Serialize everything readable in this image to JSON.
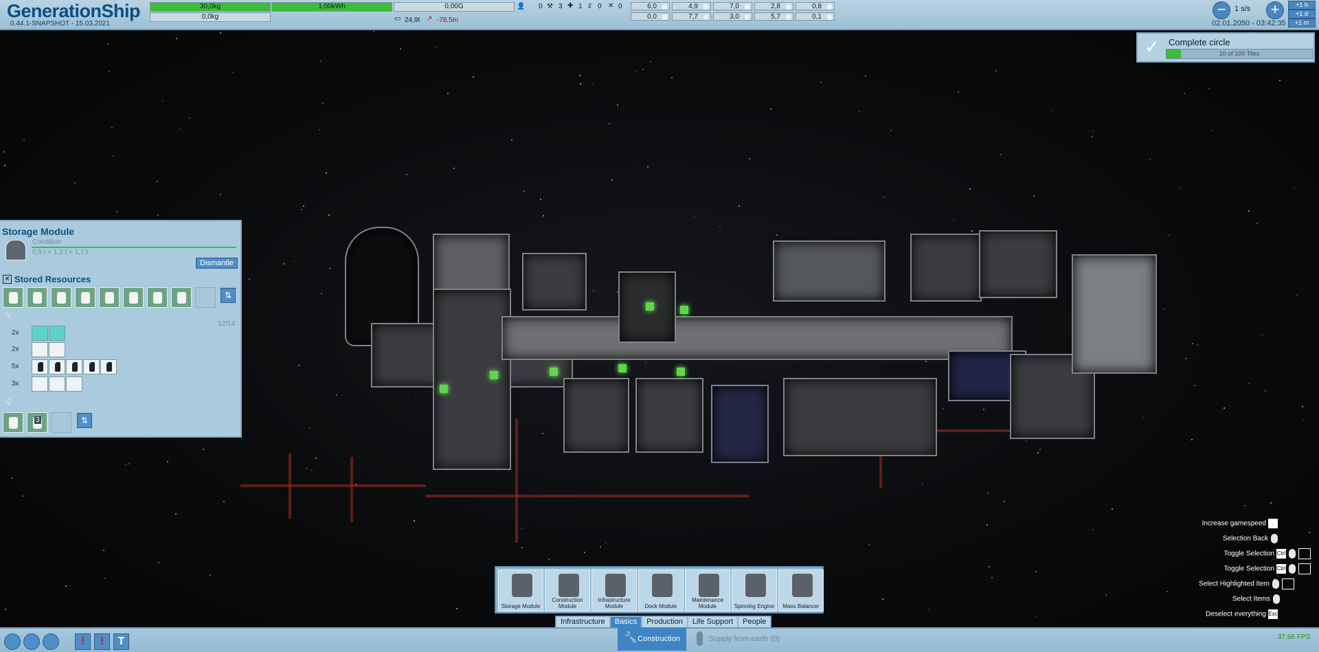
{
  "header": {
    "title": "GenerationShip",
    "version": "0.44.1-SNAPSHOT - 15.03.2021"
  },
  "resources": {
    "mass_top": {
      "label": "30,0kg",
      "level": 1.0
    },
    "mass_bottom": {
      "label": "0,0kg",
      "level": 0.0
    },
    "energy": {
      "label": "1,00kWh",
      "level": 1.0
    },
    "gravity": {
      "label": "0,00G",
      "level": 0.0
    },
    "tonnage": "24,9t",
    "rotation": "-78,5m",
    "crew_counts": [
      "0",
      "3",
      "1",
      "0",
      "0"
    ],
    "cells_row1": [
      "6,0",
      "4,9",
      "7,0",
      "2,8",
      "0,8"
    ],
    "cells_row2": [
      "0,0",
      "7,7",
      "3,0",
      "5,7",
      "0,1"
    ]
  },
  "time": {
    "speed": "1 s/s",
    "date": "02.01.2050 - 03:42:35",
    "steps": [
      "+1 h",
      "+1 d",
      "+1 m"
    ]
  },
  "goal": {
    "title": "Complete circle",
    "progress_text": "10 of 100 Tiles",
    "progress": 0.1
  },
  "info_panel": {
    "module_title": "Storage Module",
    "condition_label": "Condition",
    "mass": "0,5 t + 1,2 t = 1,7 t",
    "dismantle_label": "Dismantle",
    "stored_title": "Stored Resources",
    "capacity": "12/14",
    "row_quantities": [
      "2x",
      "2x",
      "5x",
      "3x"
    ],
    "queue_count": "3"
  },
  "build_items": [
    {
      "label": "Storage Module"
    },
    {
      "label": "Construction Module"
    },
    {
      "label": "Infrastructure Module"
    },
    {
      "label": "Dock Module"
    },
    {
      "label": "Maintenance Module"
    },
    {
      "label": "Spinning Engine"
    },
    {
      "label": "Mass Balancer"
    }
  ],
  "categories": [
    {
      "label": "Infrastructure",
      "active": false
    },
    {
      "label": "Basics",
      "active": true
    },
    {
      "label": "Production",
      "active": false
    },
    {
      "label": "Life Support",
      "active": false
    },
    {
      "label": "People",
      "active": false
    }
  ],
  "bottom": {
    "construction_label": "Construction",
    "supply_label": "Supply from earth (0)",
    "fps": "37,66 FPS"
  },
  "hotkeys": [
    {
      "label": "Increase gamespeed",
      "key": "."
    },
    {
      "label": "Selection Back",
      "key": ""
    },
    {
      "label": "Toggle Selection",
      "key": "Ctrl"
    },
    {
      "label": "Toggle Selection",
      "key": "Ctrl"
    },
    {
      "label": "Select Highlighted Item",
      "key": ""
    },
    {
      "label": "Select Items",
      "key": ""
    },
    {
      "label": "Deselect everything",
      "key": "Esc"
    }
  ],
  "colors": {
    "accent": "#0d4e84",
    "panel": "#aacbdd",
    "progress_green": "#3cbc3a",
    "button_blue": "#4f8ec7"
  }
}
